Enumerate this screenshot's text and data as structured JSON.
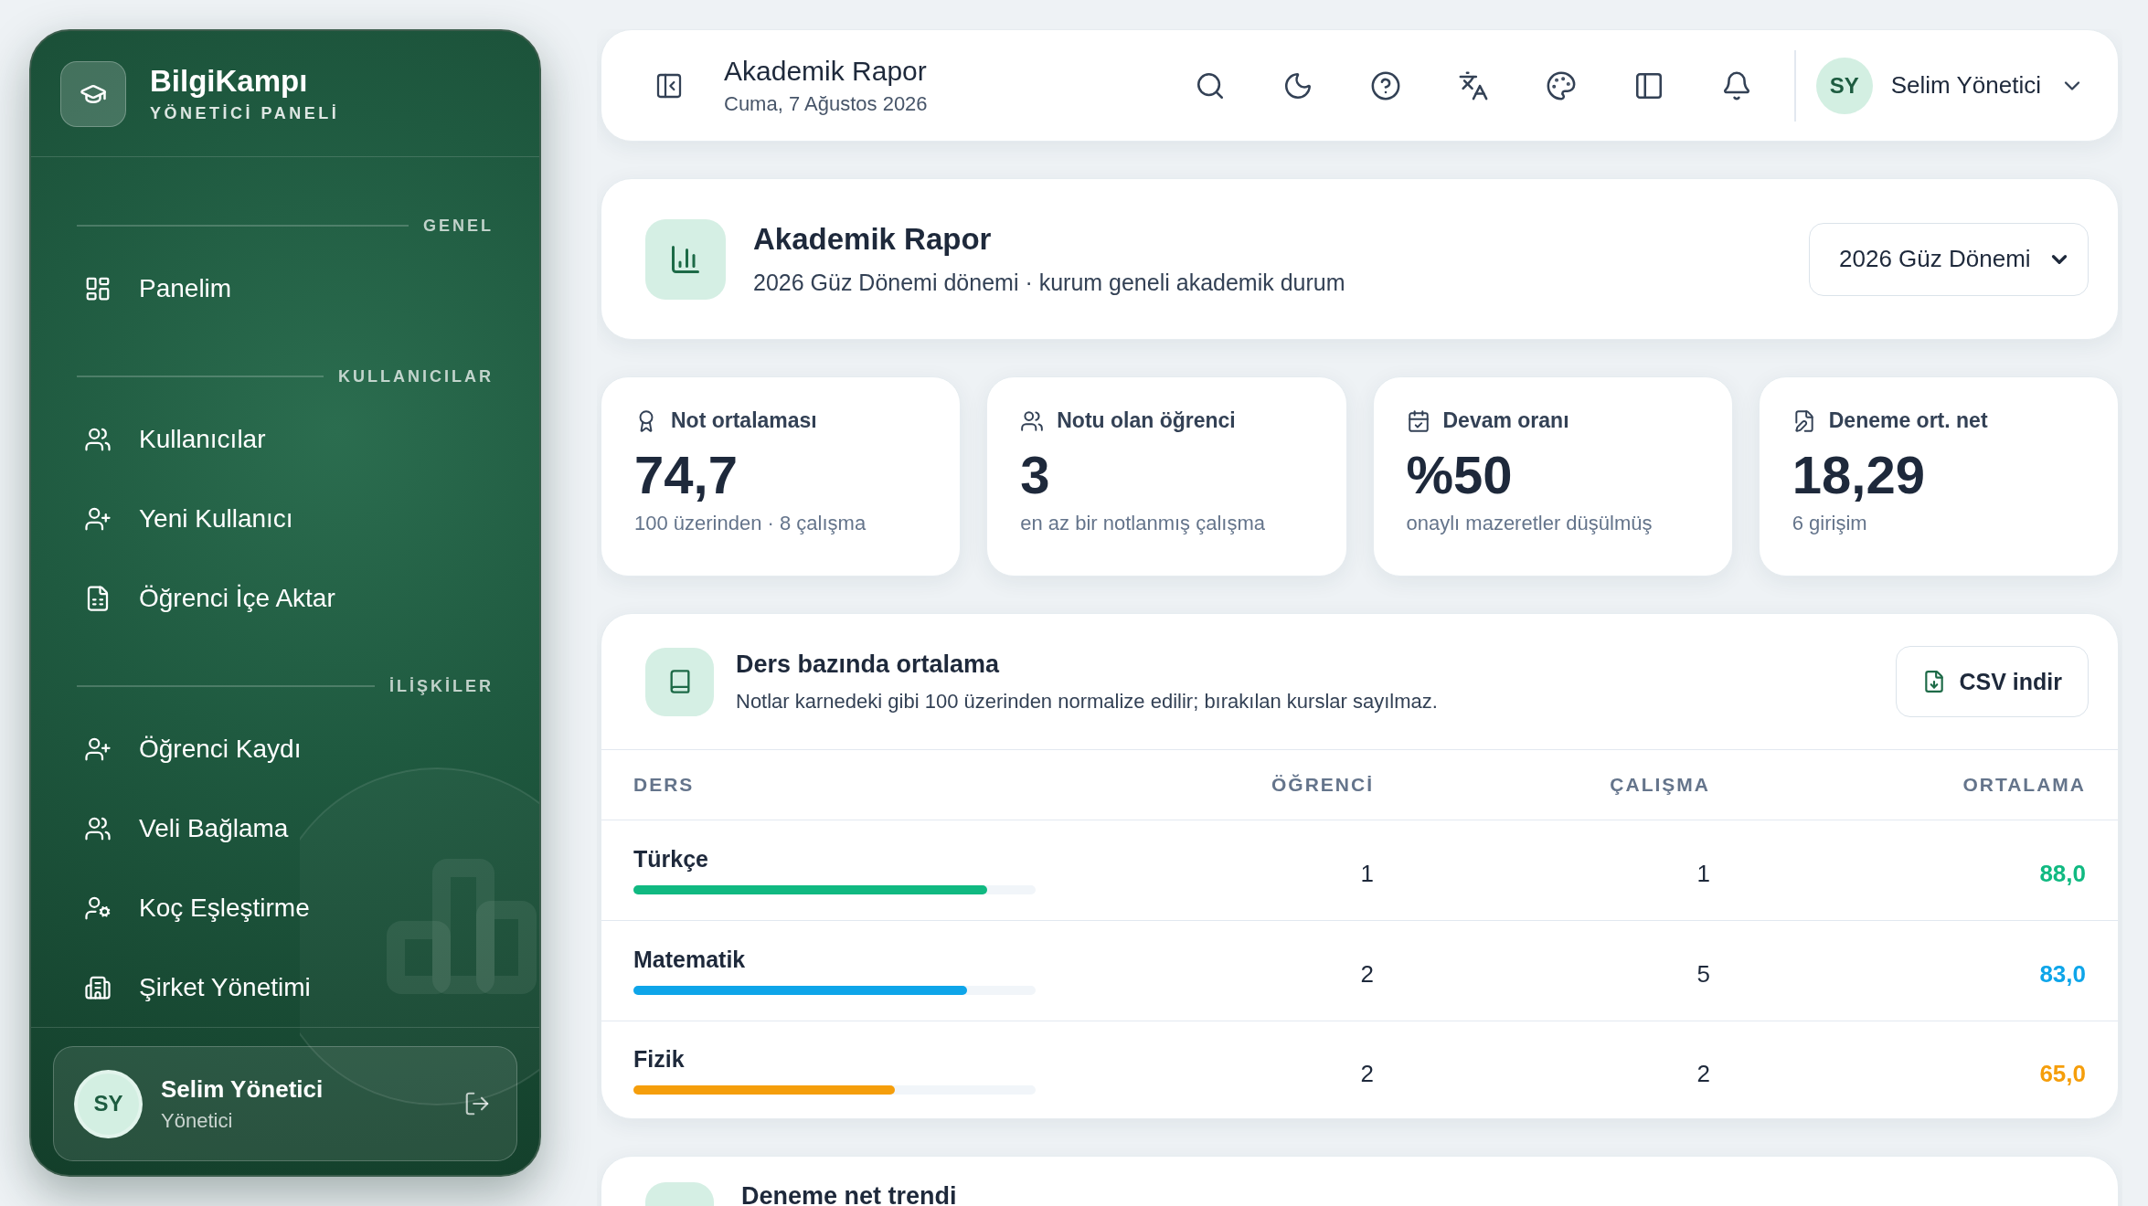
{
  "sidebar": {
    "brand": "BilgiKampı",
    "subtitle": "YÖNETİCİ PANELİ",
    "sections": [
      {
        "title": "GENEL",
        "items": [
          {
            "label": "Panelim"
          }
        ]
      },
      {
        "title": "KULLANICILAR",
        "items": [
          {
            "label": "Kullanıcılar"
          },
          {
            "label": "Yeni Kullanıcı"
          },
          {
            "label": "Öğrenci İçe Aktar"
          }
        ]
      },
      {
        "title": "İLİŞKİLER",
        "items": [
          {
            "label": "Öğrenci Kaydı"
          },
          {
            "label": "Veli Bağlama"
          },
          {
            "label": "Koç Eşleştirme"
          },
          {
            "label": "Şirket Yönetimi"
          }
        ]
      }
    ],
    "user": {
      "initials": "SY",
      "name": "Selim Yönetici",
      "role": "Yönetici"
    }
  },
  "header": {
    "title": "Akademik Rapor",
    "date": "Cuma, 7 Ağustos 2026",
    "user": {
      "initials": "SY",
      "name": "Selim Yönetici"
    }
  },
  "report": {
    "title": "Akademik Rapor",
    "subtitle": "2026 Güz Dönemi dönemi · kurum geneli akademik durum",
    "term": "2026 Güz Dönemi"
  },
  "stats": [
    {
      "label": "Not ortalaması",
      "value": "74,7",
      "note": "100 üzerinden · 8 çalışma"
    },
    {
      "label": "Notu olan öğrenci",
      "value": "3",
      "note": "en az bir notlanmış çalışma"
    },
    {
      "label": "Devam oranı",
      "value": "%50",
      "note": "onaylı mazeretler düşülmüş"
    },
    {
      "label": "Deneme ort. net",
      "value": "18,29",
      "note": "6 girişim"
    }
  ],
  "course_table": {
    "title": "Ders bazında ortalama",
    "subtitle": "Notlar karnedeki gibi 100 üzerinden normalize edilir; bırakılan kurslar sayılmaz.",
    "button": "CSV indir",
    "columns": [
      "DERS",
      "ÖĞRENCİ",
      "ÇALIŞMA",
      "ORTALAMA"
    ],
    "rows": [
      {
        "course": "Türkçe",
        "students": "1",
        "works": "1",
        "average": "88,0",
        "level": 0.88,
        "color": "#10b981"
      },
      {
        "course": "Matematik",
        "students": "2",
        "works": "5",
        "average": "83,0",
        "level": 0.83,
        "color": "#0ea5e9"
      },
      {
        "course": "Fizik",
        "students": "2",
        "works": "2",
        "average": "65,0",
        "level": 0.65,
        "color": "#f59e0b"
      }
    ]
  },
  "trend": {
    "title": "Deneme net trendi"
  }
}
